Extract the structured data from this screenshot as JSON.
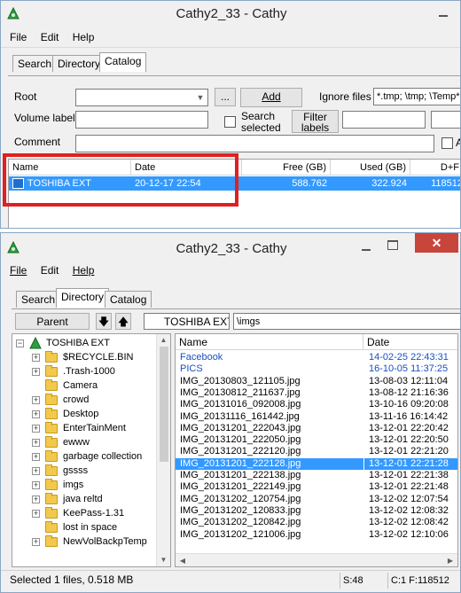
{
  "top_window": {
    "title": "Cathy2_33 - Cathy",
    "menu": [
      "File",
      "Edit",
      "Help"
    ],
    "tabs": [
      "Search",
      "Directory",
      "Catalog"
    ],
    "active_tab": "Catalog",
    "form": {
      "root_label": "Root",
      "root_browse": "...",
      "add_button": "Add",
      "ignore_files_label": "Ignore files",
      "ignore_files_value": "*.tmp; \\tmp; \\Temp*",
      "volume_label": "Volume label",
      "search_selected_label": "Search selected",
      "filter_labels_button": "Filter labels",
      "comment_label": "Comment",
      "a_label": "A"
    },
    "table": {
      "columns": [
        "Name",
        "Date",
        "Free (GB)",
        "Used (GB)",
        "D+F"
      ],
      "rows": [
        {
          "name": "TOSHIBA EXT",
          "date": "20-12-17 22:54",
          "free": "588.762",
          "used": "322.924",
          "df": "118512"
        }
      ]
    },
    "highlight_color": "#e02020"
  },
  "bottom_window": {
    "title": "Cathy2_33 - Cathy",
    "close_glyph": "✕",
    "menu": [
      "File",
      "Edit",
      "Help"
    ],
    "tabs": [
      "Search",
      "Directory",
      "Catalog"
    ],
    "active_tab": "Directory",
    "toolbar": {
      "parent_button": "Parent",
      "down_arrow": "🡇",
      "up_arrow": "🡅",
      "volume": "TOSHIBA EXT",
      "path": "\\imgs"
    },
    "tree": {
      "root": "TOSHIBA EXT",
      "items": [
        {
          "label": "$RECYCLE.BIN",
          "expand": "+"
        },
        {
          "label": ".Trash-1000",
          "expand": "+"
        },
        {
          "label": "Camera",
          "expand": ""
        },
        {
          "label": "crowd",
          "expand": "+"
        },
        {
          "label": "Desktop",
          "expand": "+"
        },
        {
          "label": "EnterTainMent",
          "expand": "+"
        },
        {
          "label": "ewww",
          "expand": "+"
        },
        {
          "label": "garbage collection",
          "expand": "+"
        },
        {
          "label": "gssss",
          "expand": "+"
        },
        {
          "label": "imgs",
          "expand": "+"
        },
        {
          "label": "java reltd",
          "expand": "+"
        },
        {
          "label": "KeePass-1.31",
          "expand": "+"
        },
        {
          "label": "lost in space",
          "expand": ""
        },
        {
          "label": "NewVolBackpTemp",
          "expand": "+"
        }
      ]
    },
    "files": {
      "columns": [
        "Name",
        "Date"
      ],
      "rows": [
        {
          "name": "Facebook",
          "date": "14-02-25 22:43:31",
          "kind": "folder"
        },
        {
          "name": "PICS",
          "date": "16-10-05 11:37:25",
          "kind": "folder"
        },
        {
          "name": "IMG_20130803_121105.jpg",
          "date": "13-08-03 12:11:04",
          "kind": "file"
        },
        {
          "name": "IMG_20130812_211637.jpg",
          "date": "13-08-12 21:16:36",
          "kind": "file"
        },
        {
          "name": "IMG_20131016_092008.jpg",
          "date": "13-10-16 09:20:08",
          "kind": "file"
        },
        {
          "name": "IMG_20131116_161442.jpg",
          "date": "13-11-16 16:14:42",
          "kind": "file"
        },
        {
          "name": "IMG_20131201_222043.jpg",
          "date": "13-12-01 22:20:42",
          "kind": "file"
        },
        {
          "name": "IMG_20131201_222050.jpg",
          "date": "13-12-01 22:20:50",
          "kind": "file"
        },
        {
          "name": "IMG_20131201_222120.jpg",
          "date": "13-12-01 22:21:20",
          "kind": "file"
        },
        {
          "name": "IMG_20131201_222128.jpg",
          "date": "13-12-01 22:21:28",
          "kind": "selected"
        },
        {
          "name": "IMG_20131201_222138.jpg",
          "date": "13-12-01 22:21:38",
          "kind": "file"
        },
        {
          "name": "IMG_20131201_222149.jpg",
          "date": "13-12-01 22:21:48",
          "kind": "file"
        },
        {
          "name": "IMG_20131202_120754.jpg",
          "date": "13-12-02 12:07:54",
          "kind": "file"
        },
        {
          "name": "IMG_20131202_120833.jpg",
          "date": "13-12-02 12:08:32",
          "kind": "file"
        },
        {
          "name": "IMG_20131202_120842.jpg",
          "date": "13-12-02 12:08:42",
          "kind": "file"
        },
        {
          "name": "IMG_20131202_121006.jpg",
          "date": "13-12-02 12:10:06",
          "kind": "file"
        }
      ]
    },
    "status": {
      "left": "Selected 1 files, 0.518 MB",
      "s": "S:48",
      "c": "C:1 F:118512"
    }
  }
}
